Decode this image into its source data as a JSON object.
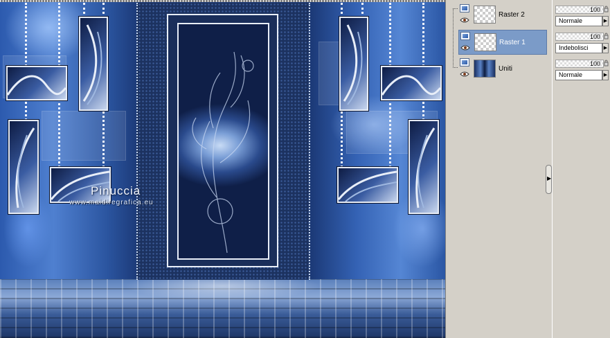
{
  "canvas": {
    "watermark_title": "Pinuccia",
    "watermark_url": "www.maidiregrafica.eu"
  },
  "layers": {
    "items": [
      {
        "name": "Raster 2",
        "selected": false,
        "icon": "raster-layer-icon"
      },
      {
        "name": "Raster 1",
        "selected": true,
        "icon": "raster-layer-icon"
      },
      {
        "name": "Uniti",
        "selected": false,
        "icon": "raster-layer-icon"
      }
    ]
  },
  "properties": {
    "items": [
      {
        "opacity": "100",
        "blend_mode": "Normale"
      },
      {
        "opacity": "100",
        "blend_mode": "Indebolisci"
      },
      {
        "opacity": "100",
        "blend_mode": "Normale"
      }
    ]
  },
  "colors": {
    "selected_row": "#7b9bc8",
    "panel_bg": "#d4d0c8",
    "canvas_blue": "#1c3260"
  }
}
